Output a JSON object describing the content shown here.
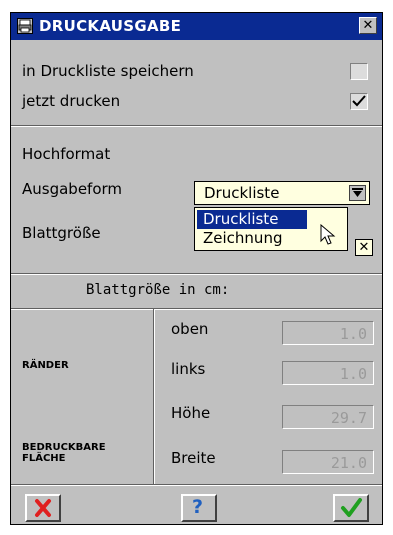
{
  "window": {
    "title": "DRUCKAUSGABE",
    "close_glyph": "✕"
  },
  "options": {
    "save_to_list_label": "in Druckliste speichern",
    "save_to_list_checked": false,
    "print_now_label": "jetzt drucken",
    "print_now_checked": true
  },
  "format": {
    "orientation_label": "Hochformat",
    "output_form_label": "Ausgabeform",
    "output_form_value": "Druckliste",
    "paper_size_label": "Blattgröße",
    "dropdown_options": [
      "Druckliste",
      "Zeichnung"
    ],
    "dropdown_selected": "Druckliste",
    "dropdown_close_glyph": "✕"
  },
  "paper": {
    "heading": "Blattgröße in cm:",
    "margins_label": "RÄNDER",
    "printable_label": "BEDRUCKBARE FLÄCHE",
    "fields": [
      {
        "label": "oben",
        "value": "1.0"
      },
      {
        "label": "links",
        "value": "1.0"
      },
      {
        "label": "Höhe",
        "value": "29.7"
      },
      {
        "label": "Breite",
        "value": "21.0"
      }
    ]
  },
  "buttons": {
    "cancel_glyph": "✕",
    "help_glyph": "?",
    "ok_glyph": "✓"
  },
  "colors": {
    "titlebar": "#0a2a92",
    "dialog_bg": "#c0c0c0",
    "combo_bg": "#ffffe0",
    "cancel": "#e02020",
    "help": "#2060c0",
    "ok": "#20a020"
  }
}
